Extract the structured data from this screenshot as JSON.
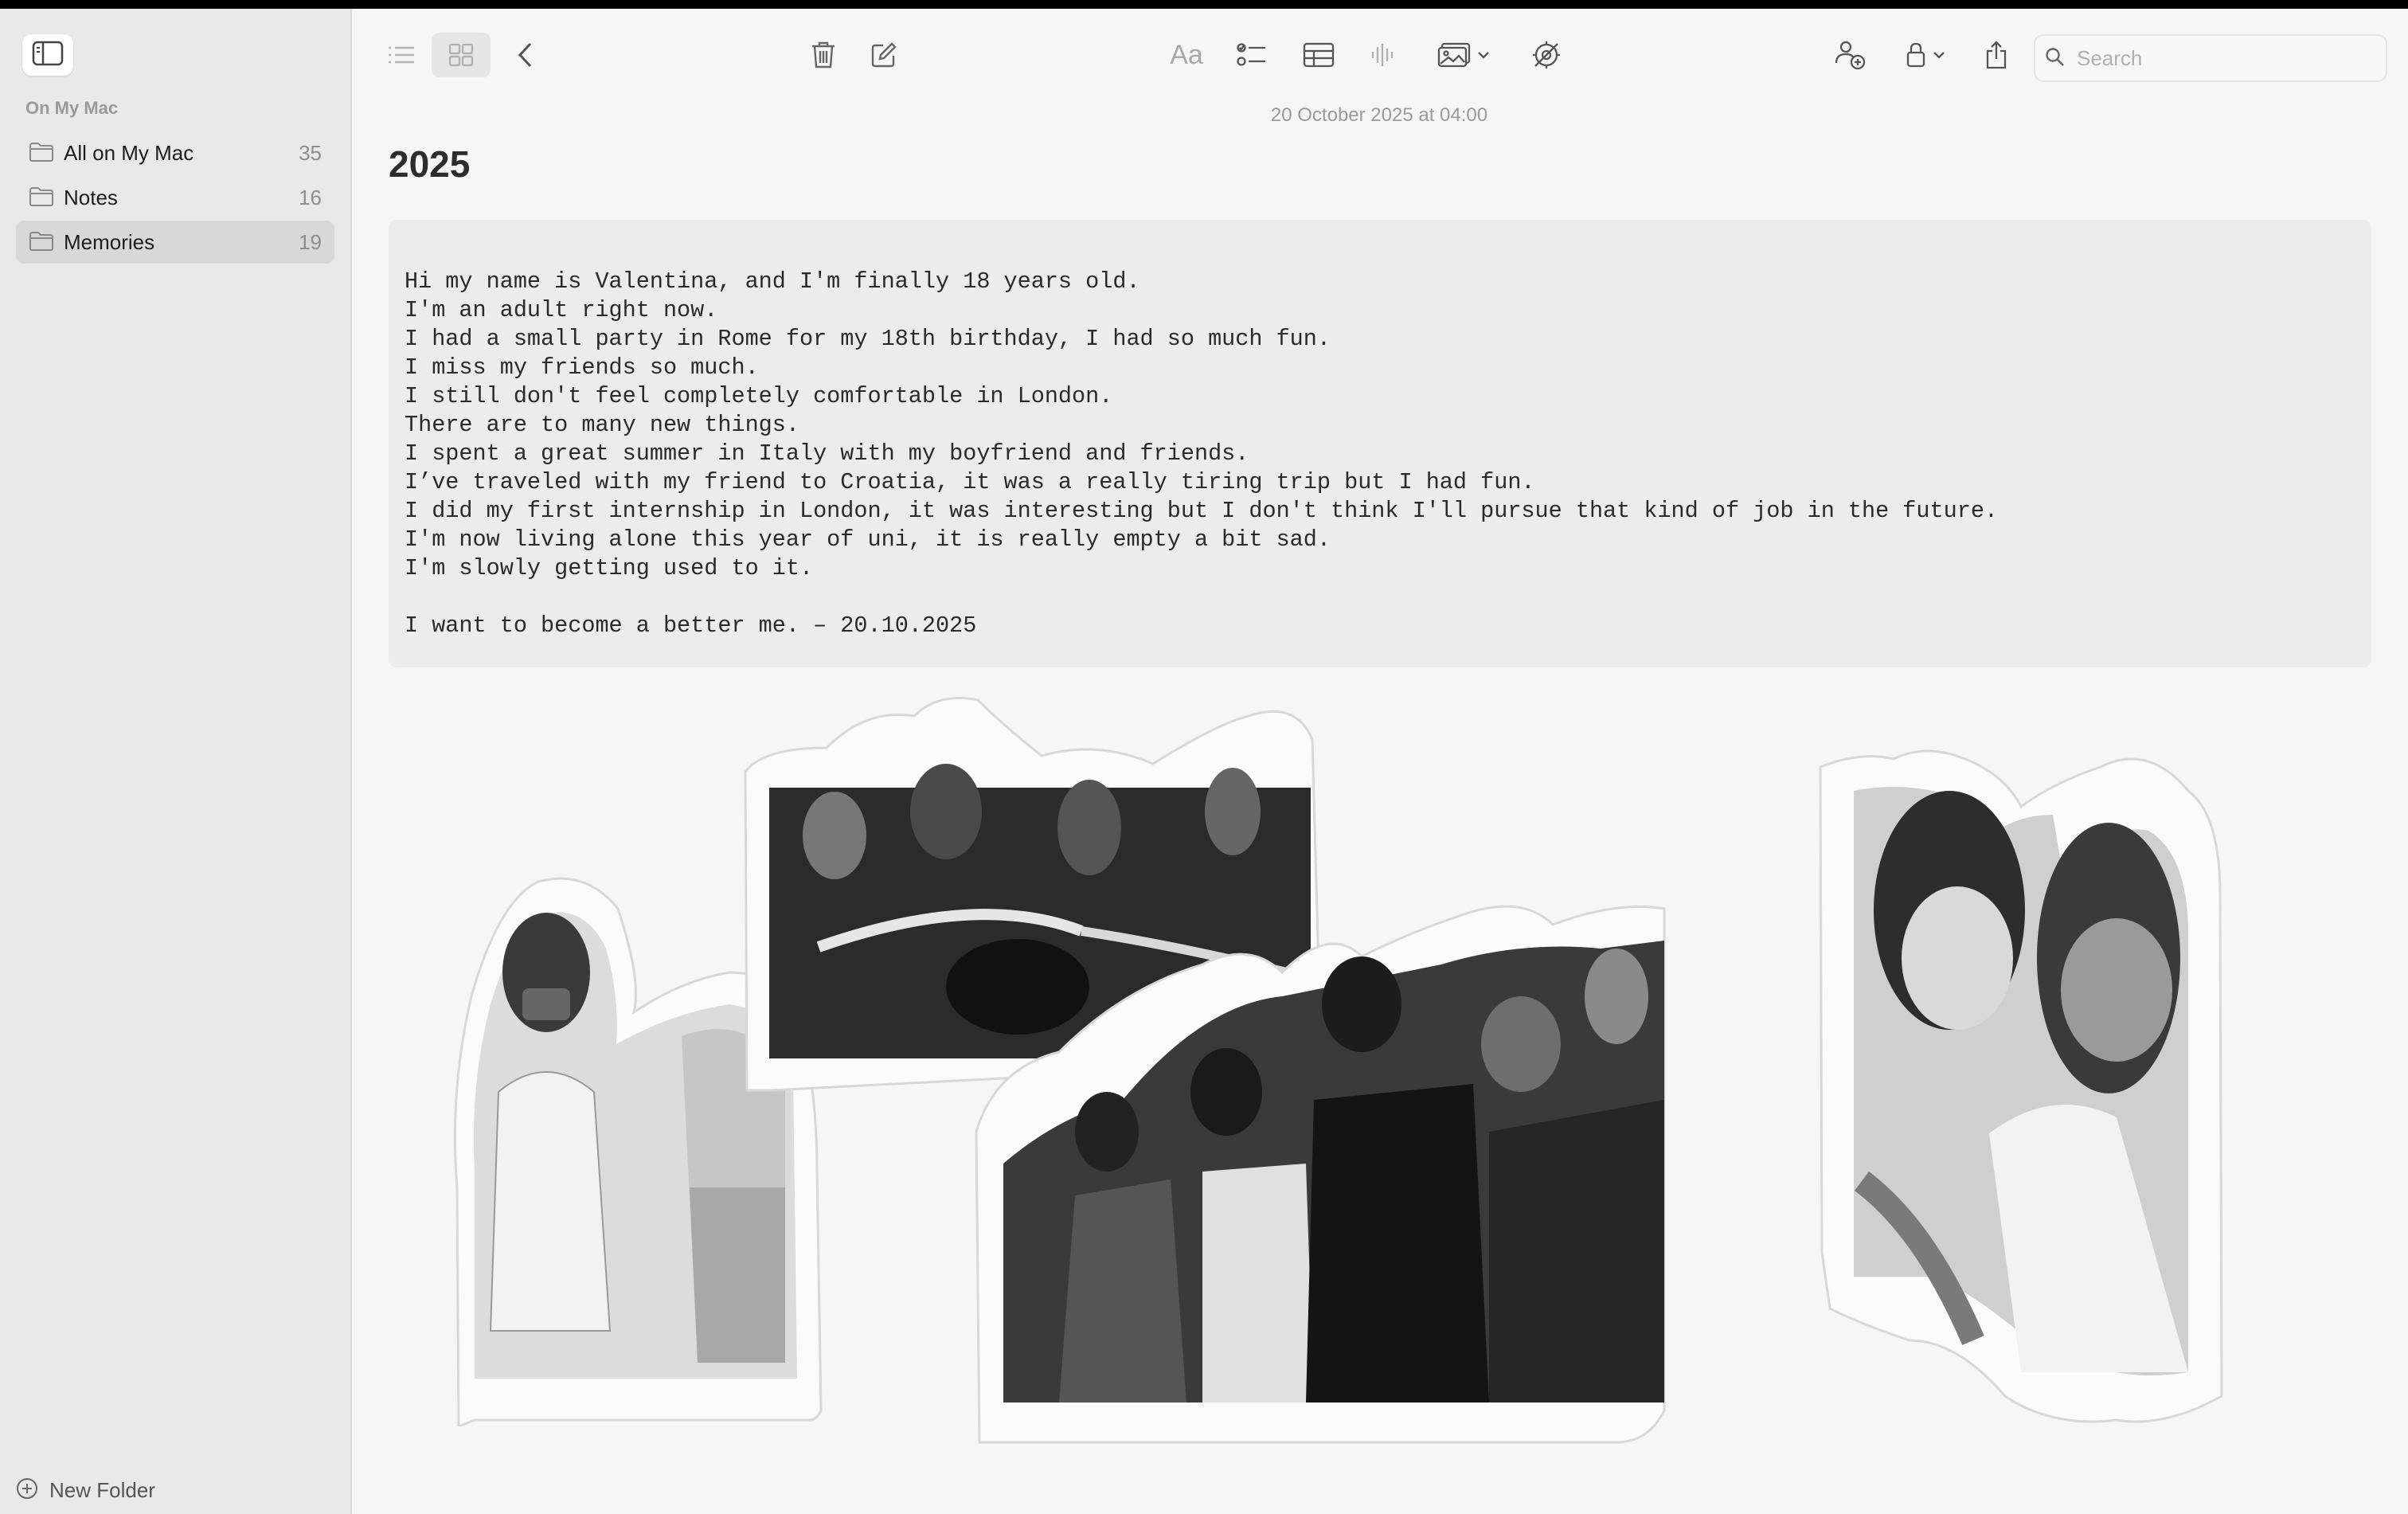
{
  "sidebar": {
    "section_label": "On My Mac",
    "folders": [
      {
        "name": "All on My Mac",
        "count": "35",
        "selected": false
      },
      {
        "name": "Notes",
        "count": "16",
        "selected": false
      },
      {
        "name": "Memories",
        "count": "19",
        "selected": true
      }
    ],
    "new_folder_label": "New Folder"
  },
  "toolbar": {
    "format_label": "Aa",
    "search_placeholder": "Search",
    "icons": [
      "list-view-icon",
      "gallery-view-icon",
      "back-icon",
      "trash-icon",
      "compose-icon",
      "format-icon",
      "checklist-icon",
      "table-icon",
      "audio-icon",
      "media-icon",
      "link-icon",
      "collaborate-icon",
      "lock-icon",
      "share-icon",
      "search-icon"
    ]
  },
  "note": {
    "timestamp": "20 October 2025 at 04:00",
    "title": "2025",
    "lines": [
      "Hi my name is Valentina, and I'm finally 18 years old.",
      "I'm an adult right now.",
      "I had a small party in Rome for my 18th birthday, I had so much fun.",
      "I miss my friends so much.",
      "I still don't feel completely comfortable in London.",
      "There are to many new things.",
      "I spent a great summer in Italy with my boyfriend and friends.",
      "I’ve traveled with my friend to Croatia, it was a really tiring trip but I had fun.",
      "I did my first internship in London, it was interesting but I don't think I'll pursue that kind of job in the future.",
      "I'm now living alone this year of uni, it is really empty a bit sad.",
      "I'm slowly getting used to it.",
      "",
      "I want to become a better me. – 20.10.2025"
    ]
  },
  "collage": {
    "photos": [
      "girl-with-camera-photo",
      "friends-group-table-photo",
      "group-hug-photo",
      "selfie-photo"
    ]
  },
  "colors": {
    "sidebar_bg": "#e9e9e9",
    "selected_bg": "#d8d8d8",
    "content_bg": "#f6f6f6",
    "code_bg": "#ececec"
  }
}
